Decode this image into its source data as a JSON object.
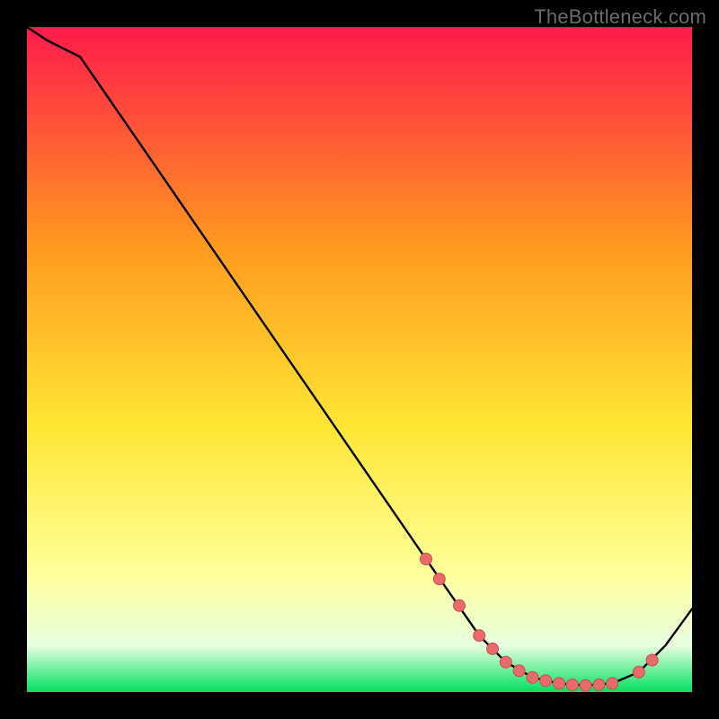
{
  "attribution": "TheBottleneck.com",
  "colors": {
    "gradient_top": "#ff1a4b",
    "gradient_mid1": "#ff9a1f",
    "gradient_mid2": "#ffe633",
    "gradient_low1": "#ffff99",
    "gradient_low2": "#e8ffe0",
    "gradient_bottom": "#00e060",
    "curve": "#000000",
    "marker_fill": "#e86a6a",
    "marker_stroke": "#c94f4f",
    "background": "#000000"
  },
  "chart_data": {
    "type": "line",
    "title": "",
    "xlabel": "",
    "ylabel": "",
    "xlim": [
      0,
      100
    ],
    "ylim": [
      0,
      100
    ],
    "series": [
      {
        "name": "bottleneck-curve",
        "x": [
          0,
          3,
          8,
          60,
          68,
          72,
          76,
          80,
          84,
          88,
          92,
          96,
          100
        ],
        "values": [
          100,
          98,
          95.5,
          20,
          8.5,
          4.5,
          2.2,
          1.3,
          1.0,
          1.3,
          3.0,
          7.0,
          12.5
        ]
      }
    ],
    "markers": {
      "name": "highlight-points",
      "x": [
        60,
        62,
        65,
        68,
        70,
        72,
        74,
        76,
        78,
        80,
        82,
        84,
        86,
        88,
        92,
        94
      ],
      "values": [
        20,
        17,
        13,
        8.5,
        6.5,
        4.5,
        3.2,
        2.2,
        1.7,
        1.3,
        1.1,
        1.0,
        1.1,
        1.3,
        3.0,
        4.8
      ]
    }
  }
}
